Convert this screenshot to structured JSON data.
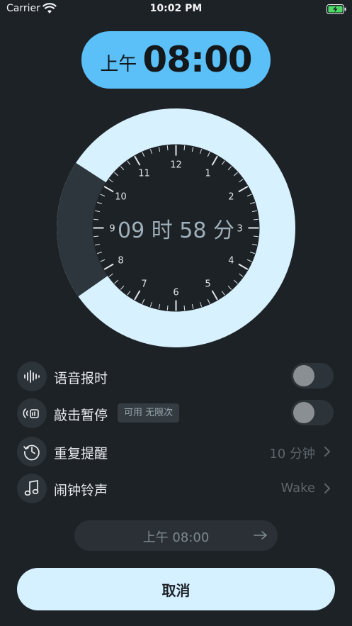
{
  "status_bar": {
    "carrier": "Carrier",
    "time": "10:02 PM"
  },
  "alarm_time": {
    "ampm": "上午",
    "time": "08:00"
  },
  "dial": {
    "remaining": "09 时 58 分",
    "numbers": [
      "12",
      "1",
      "2",
      "3",
      "4",
      "5",
      "6",
      "7",
      "8",
      "9",
      "10",
      "11"
    ],
    "colors": {
      "ring": "#d8f1ff",
      "elapsed": "#2c363c",
      "face": "#1d2226"
    }
  },
  "settings": {
    "voice": {
      "label": "语音报时",
      "icon": "waveform-icon",
      "enabled": false
    },
    "tap_pause": {
      "label": "敲击暂停",
      "badge": "可用 无限次",
      "icon": "tap-icon",
      "enabled": false
    },
    "repeat": {
      "label": "重复提醒",
      "value": "10 分钟",
      "icon": "clock-repeat-icon"
    },
    "ringtone": {
      "label": "闹钟铃声",
      "value": "Wake",
      "icon": "music-note-icon"
    }
  },
  "next_alarm": {
    "text": "上午 08:00"
  },
  "cancel_label": "取消",
  "accent_color": "#5bc0f8"
}
